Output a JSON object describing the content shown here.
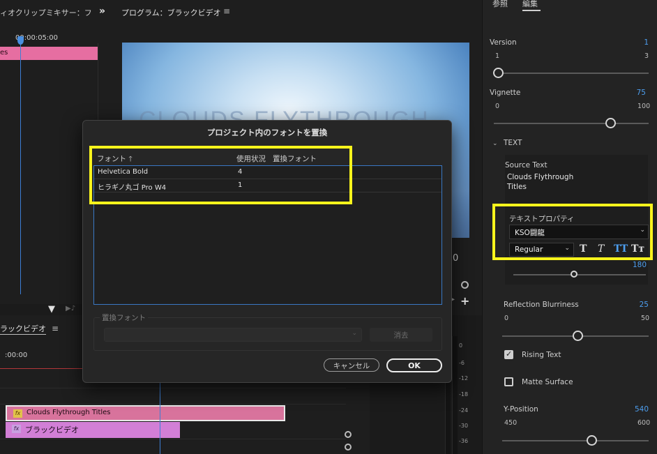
{
  "clip_mixer": {
    "tab_title": "ィオクリップミキサー：フ",
    "timecode": "00:00:05:00",
    "clip_label": "es"
  },
  "program_monitor": {
    "title": "プログラム：ブラックビデオ",
    "video_title_text": "CLOUDS FLYTHROUGH",
    "side_value": "0"
  },
  "timeline": {
    "tab_label": "ラックビデオ",
    "timecode": ":00:00",
    "clips": [
      {
        "label": "Clouds Flythrough Titles",
        "fx": "fx"
      },
      {
        "label": "ブラックビデオ",
        "fx": "fx"
      }
    ],
    "meter_scale": [
      "0",
      "-6",
      "-12",
      "-18",
      "-24",
      "-30",
      "-36"
    ]
  },
  "essential_graphics": {
    "tabs": [
      "参照",
      "編集"
    ],
    "version": {
      "label": "Version",
      "value": "1",
      "min": "1",
      "max": "3",
      "level": 0.0
    },
    "vignette": {
      "label": "Vignette",
      "value": "75",
      "min": "0",
      "max": "100",
      "level": 0.75
    },
    "text_section": "TEXT",
    "source_text_label": "Source Text",
    "source_text_value_line1": "Clouds Flythrough",
    "source_text_value_line2": "Titles",
    "text_properties_label": "テキストプロパティ",
    "font_name": "KSO闘龍",
    "font_style": "Regular",
    "style_buttons": [
      "T",
      "T",
      "TT",
      "Tт"
    ],
    "size_value": "180",
    "reflection_blurriness": {
      "label": "Reflection Blurriness",
      "value": "25",
      "min": "0",
      "max": "50",
      "level": 0.5
    },
    "rising_text": {
      "label": "Rising Text",
      "checked": true
    },
    "matte_surface": {
      "label": "Matte Surface",
      "checked": false
    },
    "y_position": {
      "label": "Y-Position",
      "value": "540",
      "min": "450",
      "max": "600",
      "level": 0.6
    }
  },
  "dialog": {
    "title": "プロジェクト内のフォントを置換",
    "col_font": "フォント",
    "sort_icon": "🡑",
    "col_usage": "使用状況",
    "col_replace": "置換フォント",
    "rows": [
      {
        "font": "Helvetica Bold",
        "usage": "4"
      },
      {
        "font": "ヒラギノ丸ゴ Pro W4",
        "usage": "1"
      }
    ],
    "replace_font_label": "置換フォント",
    "delete_label": "消去",
    "cancel_label": "キャンセル",
    "ok_label": "OK"
  },
  "colors": {
    "highlight": "#f8f41c",
    "accent_blue": "#4d9ff0",
    "title_clip": "#d8739c",
    "black_video_clip": "#d27fd6"
  }
}
